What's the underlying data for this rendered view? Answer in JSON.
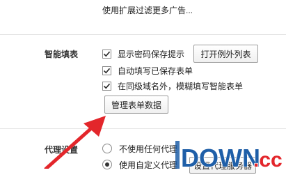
{
  "top_note": "使用扩展过滤更多广告...",
  "autofill": {
    "title": "智能填表",
    "options": [
      {
        "label": "显示密码保存提示",
        "checked": true
      },
      {
        "label": "自动填写已保存表单",
        "checked": true
      },
      {
        "label": "在同级域名外，模糊填写智能表单",
        "checked": true
      }
    ],
    "exceptions_button": "打开例外列表",
    "manage_button": "管理表单数据"
  },
  "proxy": {
    "title": "代理设置",
    "options": [
      {
        "label": "不使用任何代理",
        "selected": false
      },
      {
        "label": "使用自定义代理",
        "selected": true
      }
    ],
    "server_button_partial": "设置代理服务器"
  },
  "watermark": {
    "text": "DOWN",
    "suffix": ".cc"
  },
  "colors": {
    "arrow": "#e3262b",
    "watermark_blue": "#1f5fa8",
    "watermark_red": "#e3262b"
  }
}
